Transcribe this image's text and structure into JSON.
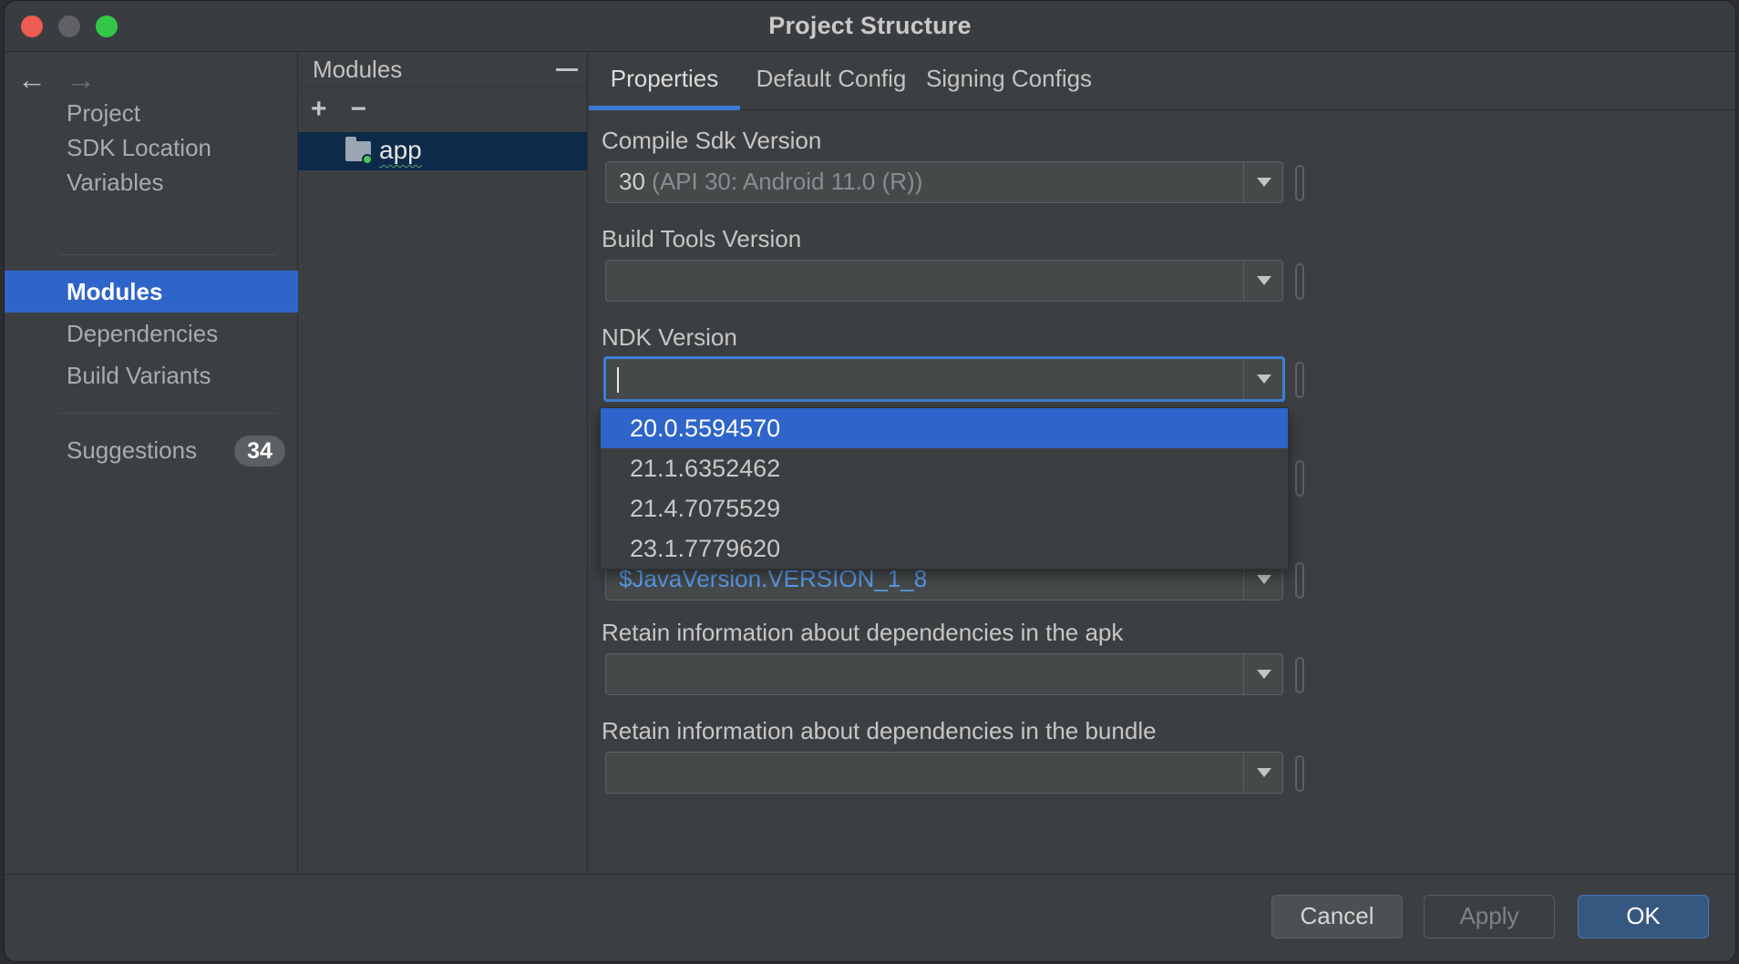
{
  "window": {
    "title": "Project Structure"
  },
  "nav": {
    "back_icon": "arrow-left-icon",
    "forward_icon": "arrow-right-icon",
    "group1": [
      {
        "label": "Project"
      },
      {
        "label": "SDK Location"
      },
      {
        "label": "Variables"
      }
    ],
    "group2": [
      {
        "label": "Modules",
        "active": true
      },
      {
        "label": "Dependencies"
      },
      {
        "label": "Build Variants"
      }
    ],
    "suggestions": {
      "label": "Suggestions",
      "count": "34"
    }
  },
  "modules": {
    "title": "Modules",
    "add_symbol": "+",
    "remove_symbol": "−",
    "items": [
      {
        "name": "app"
      }
    ]
  },
  "tabs": [
    {
      "label": "Properties",
      "active": true
    },
    {
      "label": "Default Config"
    },
    {
      "label": "Signing Configs"
    }
  ],
  "fields": {
    "compile_sdk": {
      "label": "Compile Sdk Version",
      "value": "30",
      "hint": "(API 30: Android 11.0 (R))"
    },
    "build_tools": {
      "label": "Build Tools Version",
      "value": ""
    },
    "ndk": {
      "label": "NDK Version",
      "value": ""
    },
    "java_version": {
      "value": "$JavaVersion.VERSION_1_8"
    },
    "retain_apk": {
      "label": "Retain information about dependencies in the apk",
      "value": ""
    },
    "retain_bundle": {
      "label": "Retain information about dependencies in the bundle",
      "value": ""
    }
  },
  "ndk_dropdown": {
    "options": [
      "20.0.5594570",
      "21.1.6352462",
      "21.4.7075529",
      "23.1.7779620"
    ],
    "selected": "20.0.5594570"
  },
  "footer": {
    "cancel": "Cancel",
    "apply": "Apply",
    "ok": "OK"
  },
  "colors": {
    "accent": "#2f65ca",
    "focus": "#3d7fd8",
    "link": "#5a9be8",
    "module_badge": "#4fc15b"
  }
}
